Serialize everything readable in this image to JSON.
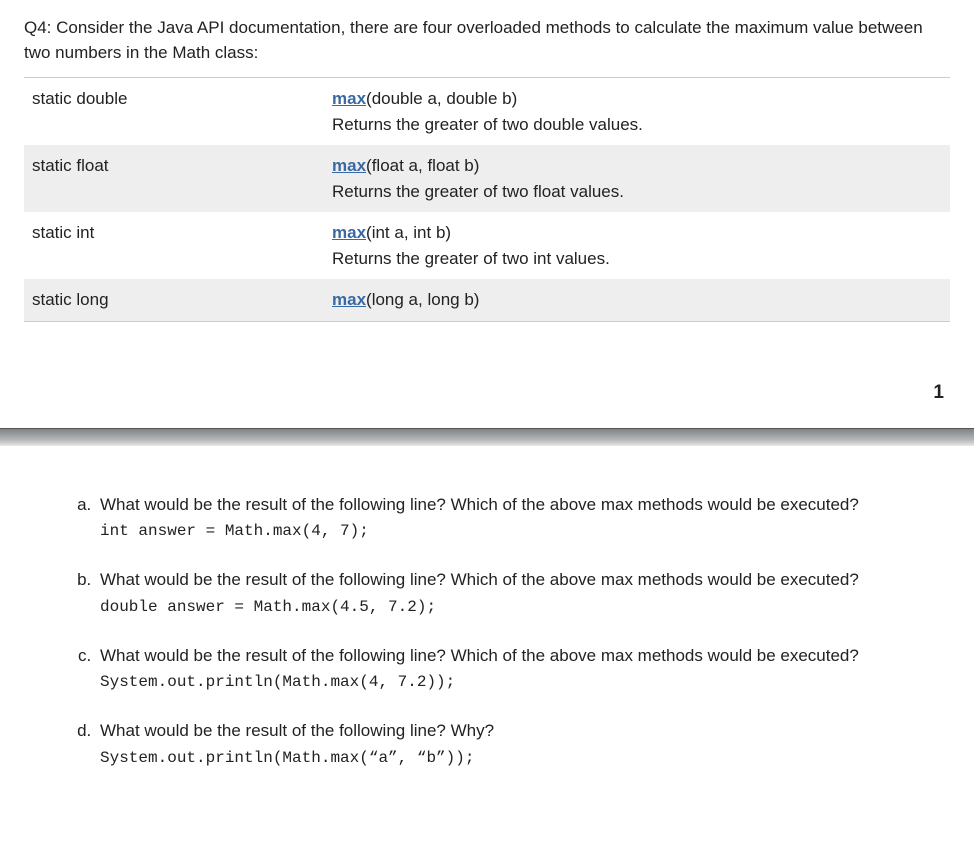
{
  "intro": "Q4: Consider the Java API documentation, there are four overloaded methods to calculate the maximum value between two numbers in the Math class:",
  "api_rows": [
    {
      "modifier": "static double",
      "method": "max",
      "sig": "(double a, double b)",
      "desc": "Returns the greater of two double values."
    },
    {
      "modifier": "static float",
      "method": "max",
      "sig": "(float a, float b)",
      "desc": "Returns the greater of two float values."
    },
    {
      "modifier": "static int",
      "method": "max",
      "sig": "(int a, int b)",
      "desc": "Returns the greater of two int values."
    },
    {
      "modifier": "static long",
      "method": "max",
      "sig": "(long a, long b)",
      "desc": ""
    }
  ],
  "page_number": "1",
  "parts": {
    "a": {
      "q": "What would be the result of the following line? Which of the above max methods would be executed?",
      "code": "int answer = Math.max(4, 7);"
    },
    "b": {
      "q": "What would be the result of the following line? Which of the above max methods would be executed?",
      "code": "double answer = Math.max(4.5, 7.2);"
    },
    "c": {
      "q": "What would be the result of the following line? Which of the above max methods would be executed?",
      "code": "System.out.println(Math.max(4, 7.2));"
    },
    "d": {
      "q": "What would be the result of the following line? Why?",
      "code": "System.out.println(Math.max(“a”, “b”));"
    }
  }
}
